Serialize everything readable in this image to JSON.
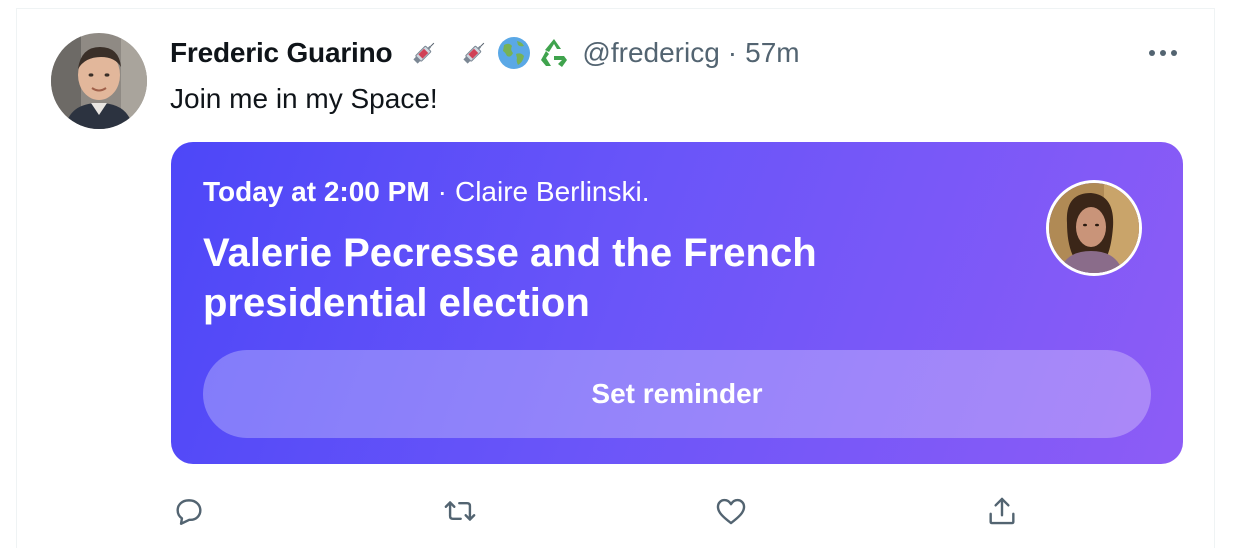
{
  "tweet": {
    "display_name": "Frederic Guarino",
    "emojis": [
      "syringe-emoji",
      "syringe-emoji",
      "globe-emoji",
      "recycle-emoji"
    ],
    "handle": "@fredericg",
    "separator": "·",
    "time": "57m",
    "text": "Join me in my Space!"
  },
  "space": {
    "when": "Today at 2:00 PM",
    "separator": "·",
    "host": "Claire Berlinski.",
    "title": "Valerie Pecresse and the French presidential election",
    "reminder_label": "Set reminder",
    "gradient_colors": [
      "#4d47f8",
      "#6a55f9",
      "#8d5cf6"
    ]
  },
  "actions": [
    "reply-icon",
    "retweet-icon",
    "like-icon",
    "share-icon"
  ],
  "colors": {
    "text_primary": "#0f1419",
    "text_secondary": "#536471",
    "border": "#eff3f4"
  }
}
